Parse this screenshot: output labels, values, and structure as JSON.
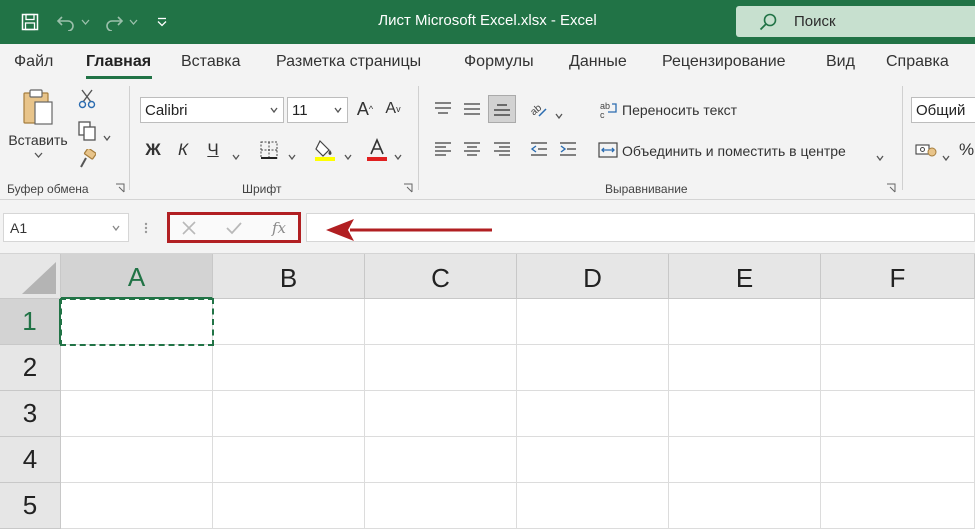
{
  "title_bar": {
    "title": "Лист Microsoft Excel.xlsx  -  Excel",
    "search_label": "Поиск"
  },
  "menu": {
    "tabs": [
      "Файл",
      "Главная",
      "Вставка",
      "Разметка страницы",
      "Формулы",
      "Данные",
      "Рецензирование",
      "Вид",
      "Справка"
    ],
    "active_tab": "Главная"
  },
  "ribbon": {
    "clipboard": {
      "paste_label": "Вставить",
      "group_label": "Буфер обмена"
    },
    "font": {
      "font_name": "Calibri",
      "font_size": "11",
      "bold": "Ж",
      "italic": "К",
      "underline": "Ч",
      "group_label": "Шрифт",
      "highlight_color": "#ffff00",
      "font_color": "#e02020"
    },
    "alignment": {
      "wrap_text": "Переносить текст",
      "merge_center": "Объединить и поместить в центре",
      "group_label": "Выравнивание"
    },
    "number": {
      "format": "Общий"
    }
  },
  "formula_bar": {
    "name_box": "A1",
    "cancel_icon": "close-icon",
    "enter_icon": "check-icon",
    "function_label": "fx",
    "formula_value": ""
  },
  "annotation": {
    "highlight_color": "#b11f22"
  },
  "sheet": {
    "columns": [
      "A",
      "B",
      "C",
      "D",
      "E",
      "F"
    ],
    "rows": [
      "1",
      "2",
      "3",
      "4",
      "5"
    ],
    "active_cell": "A1",
    "accent_color": "#217346"
  }
}
